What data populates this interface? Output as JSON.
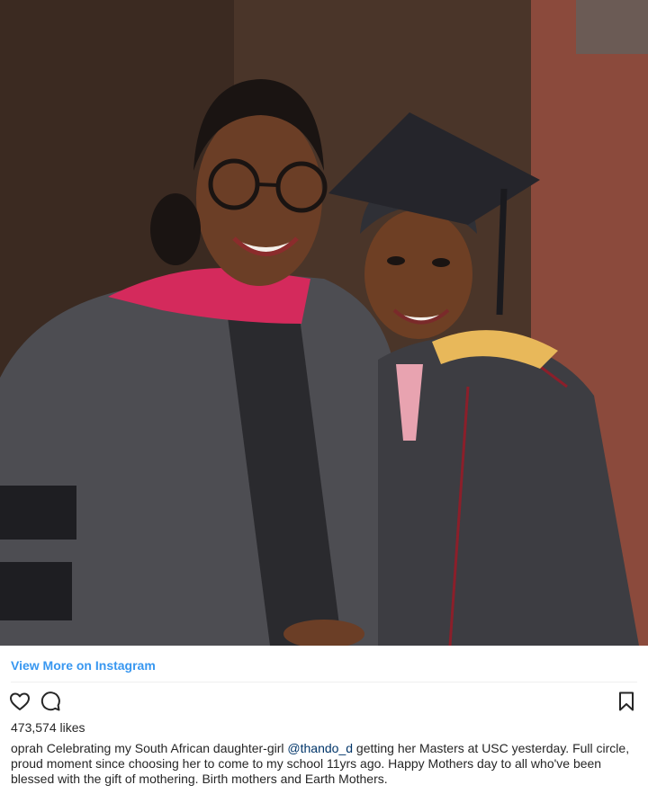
{
  "post": {
    "photo_alt": "",
    "view_more_label": "View More on Instagram",
    "likes_text": "473,574 likes",
    "caption": {
      "username": "oprah",
      "text_before": "Celebrating my South African daughter-girl",
      "mention": "@thando_d",
      "text_after": "getting her Masters at USC yesterday. Full circle, proud moment since choosing her to come to my school 11yrs ago. Happy Mothers day to all who've been blessed with the gift of mothering. Birth mothers and Earth Mothers."
    },
    "icons": {
      "like": "heart-icon",
      "comment": "comment-icon",
      "save": "bookmark-icon"
    },
    "colors": {
      "link": "#3897f0",
      "mention": "#003569",
      "text": "#262626"
    }
  }
}
